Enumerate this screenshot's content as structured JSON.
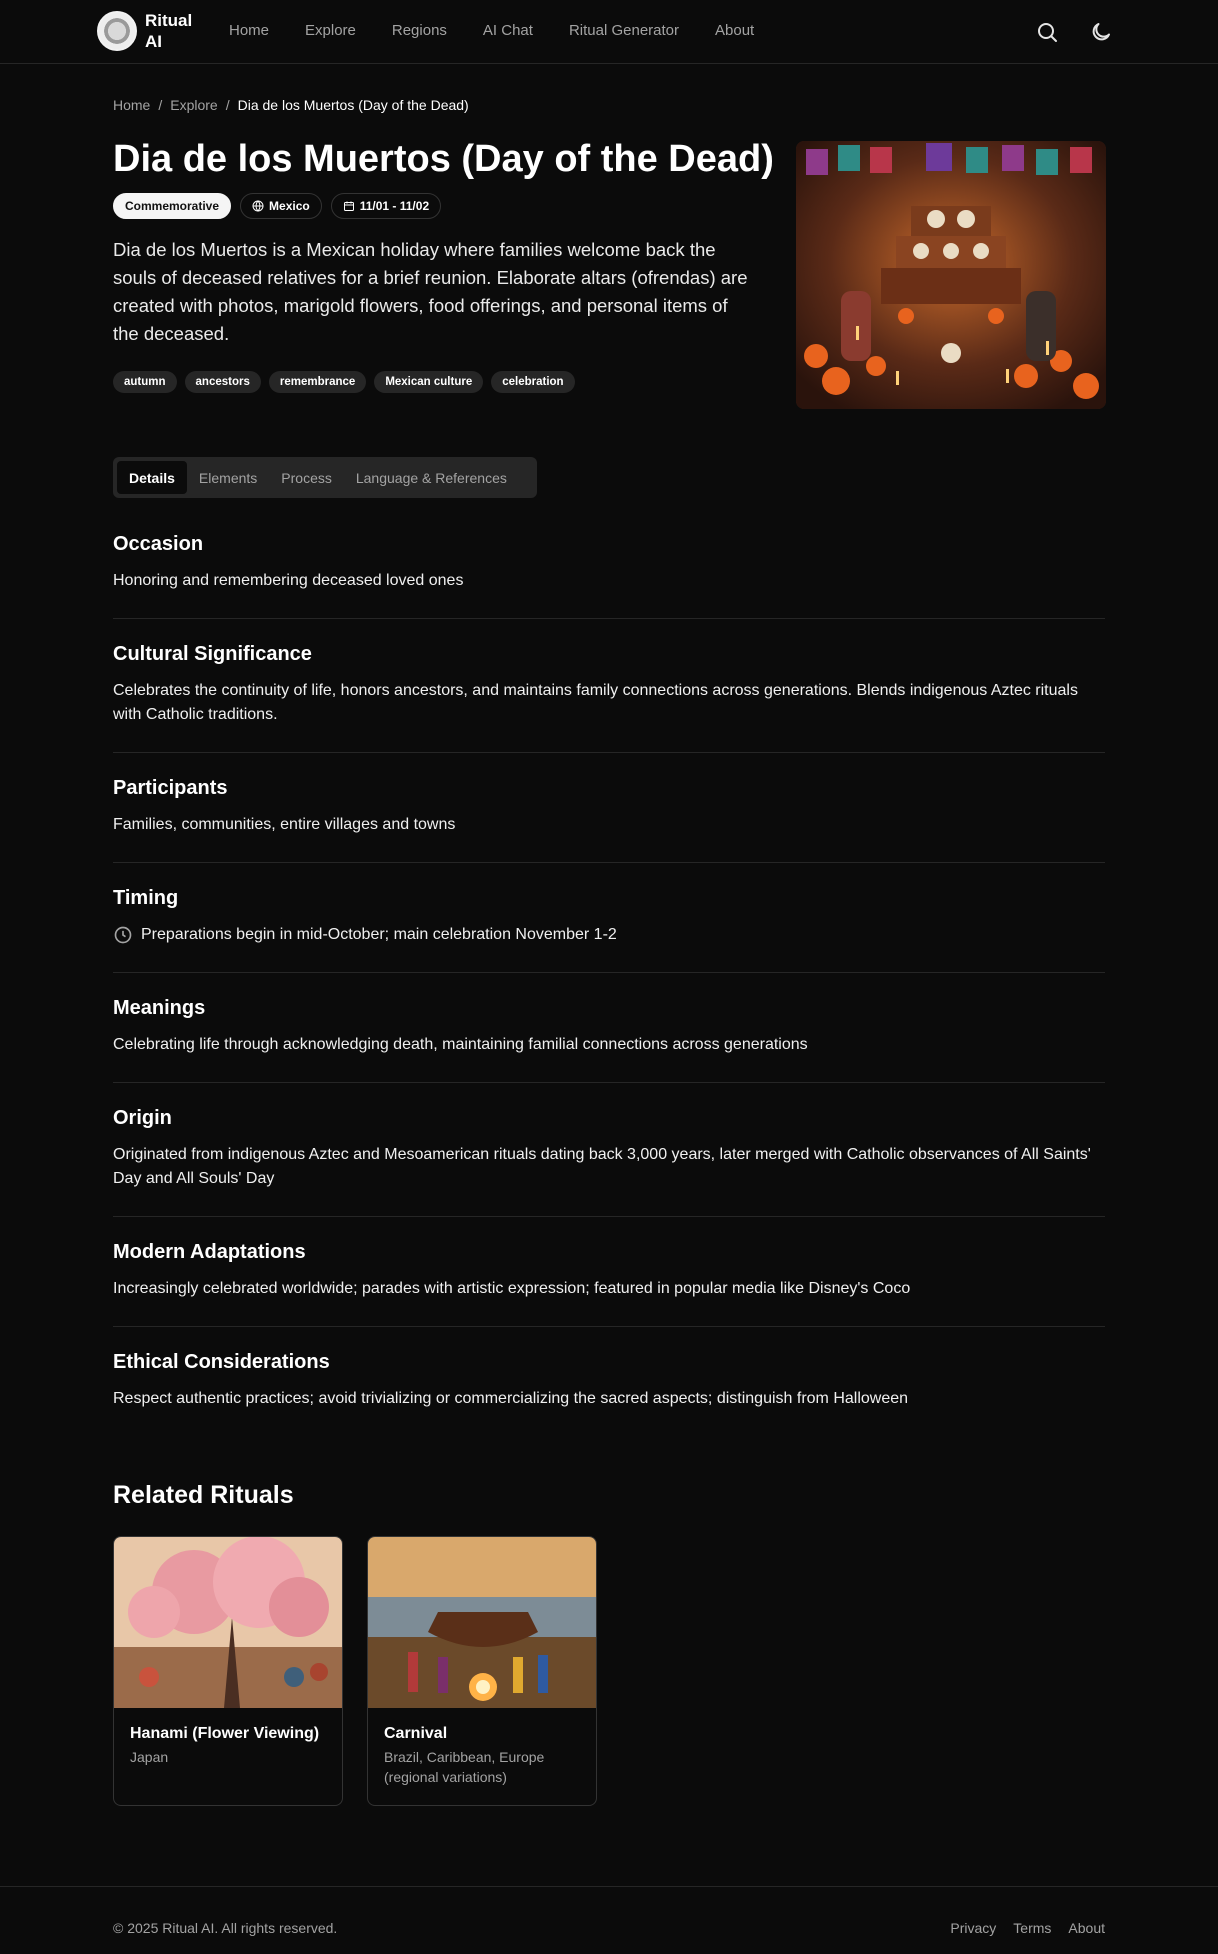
{
  "app": {
    "brand": "Ritual AI"
  },
  "nav": {
    "items": [
      "Home",
      "Explore",
      "Regions",
      "AI Chat",
      "Ritual Generator",
      "About"
    ]
  },
  "breadcrumb": {
    "items": [
      "Home",
      "Explore",
      "Dia de los Muertos (Day of the Dead)"
    ]
  },
  "ritual": {
    "title": "Dia de los Muertos (Day of the Dead)",
    "type": "Commemorative",
    "region": "Mexico",
    "dates": "11/01 - 11/02",
    "description": "Dia de los Muertos is a Mexican holiday where families welcome back the souls of deceased relatives for a brief reunion. Elaborate altars (ofrendas) are created with photos, marigold flowers, food offerings, and personal items of the deceased.",
    "tags": [
      "autumn",
      "ancestors",
      "remembrance",
      "Mexican culture",
      "celebration"
    ]
  },
  "tabs": [
    "Details",
    "Elements",
    "Process",
    "Language & References"
  ],
  "sections": [
    {
      "heading": "Occasion",
      "text": "Honoring and remembering deceased loved ones"
    },
    {
      "heading": "Cultural Significance",
      "text": "Celebrates the continuity of life, honors ancestors, and maintains family connections across generations. Blends indigenous Aztec rituals with Catholic traditions."
    },
    {
      "heading": "Participants",
      "text": "Families, communities, entire villages and towns"
    },
    {
      "heading": "Timing",
      "text": "Preparations begin in mid-October; main celebration November 1-2"
    },
    {
      "heading": "Meanings",
      "text": "Celebrating life through acknowledging death, maintaining familial connections across generations"
    },
    {
      "heading": "Origin",
      "text": "Originated from indigenous Aztec and Mesoamerican rituals dating back 3,000 years, later merged with Catholic observances of All Saints' Day and All Souls' Day"
    },
    {
      "heading": "Modern Adaptations",
      "text": "Increasingly celebrated worldwide; parades with artistic expression; featured in popular media like Disney's Coco"
    },
    {
      "heading": "Ethical Considerations",
      "text": "Respect authentic practices; avoid trivializing or commercializing the sacred aspects; distinguish from Halloween"
    }
  ],
  "related": {
    "heading": "Related Rituals",
    "items": [
      {
        "title": "Hanami (Flower Viewing)",
        "subtitle": "Japan"
      },
      {
        "title": "Carnival",
        "subtitle": "Brazil, Caribbean, Europe (regional variations)"
      }
    ]
  },
  "footer": {
    "copyright": "© 2025 Ritual AI. All rights reserved.",
    "links": [
      "Privacy",
      "Terms",
      "About"
    ]
  },
  "icons": {
    "search": "search-icon",
    "theme": "moon-icon",
    "region": "globe-icon",
    "dates": "calendar-icon",
    "timing": "clock-icon"
  }
}
